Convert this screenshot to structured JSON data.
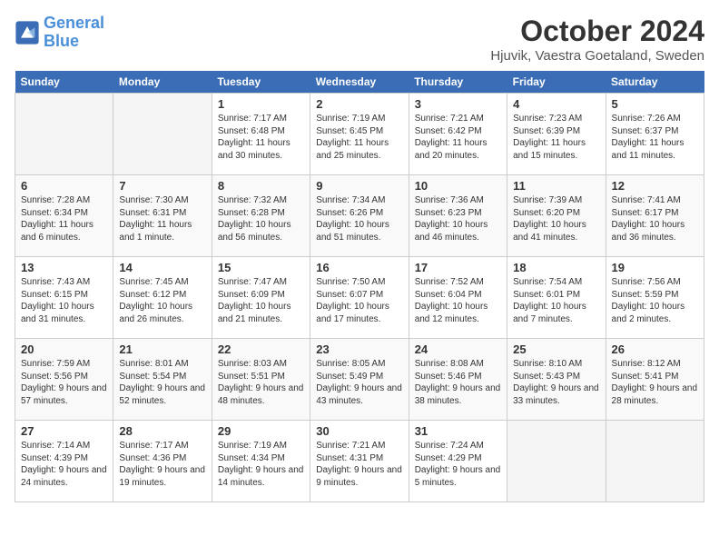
{
  "header": {
    "logo_line1": "General",
    "logo_line2": "Blue",
    "month": "October 2024",
    "location": "Hjuvik, Vaestra Goetaland, Sweden"
  },
  "weekdays": [
    "Sunday",
    "Monday",
    "Tuesday",
    "Wednesday",
    "Thursday",
    "Friday",
    "Saturday"
  ],
  "weeks": [
    [
      {
        "day": "",
        "empty": true
      },
      {
        "day": "",
        "empty": true
      },
      {
        "day": "1",
        "sunrise": "Sunrise: 7:17 AM",
        "sunset": "Sunset: 6:48 PM",
        "daylight": "Daylight: 11 hours and 30 minutes."
      },
      {
        "day": "2",
        "sunrise": "Sunrise: 7:19 AM",
        "sunset": "Sunset: 6:45 PM",
        "daylight": "Daylight: 11 hours and 25 minutes."
      },
      {
        "day": "3",
        "sunrise": "Sunrise: 7:21 AM",
        "sunset": "Sunset: 6:42 PM",
        "daylight": "Daylight: 11 hours and 20 minutes."
      },
      {
        "day": "4",
        "sunrise": "Sunrise: 7:23 AM",
        "sunset": "Sunset: 6:39 PM",
        "daylight": "Daylight: 11 hours and 15 minutes."
      },
      {
        "day": "5",
        "sunrise": "Sunrise: 7:26 AM",
        "sunset": "Sunset: 6:37 PM",
        "daylight": "Daylight: 11 hours and 11 minutes."
      }
    ],
    [
      {
        "day": "6",
        "sunrise": "Sunrise: 7:28 AM",
        "sunset": "Sunset: 6:34 PM",
        "daylight": "Daylight: 11 hours and 6 minutes."
      },
      {
        "day": "7",
        "sunrise": "Sunrise: 7:30 AM",
        "sunset": "Sunset: 6:31 PM",
        "daylight": "Daylight: 11 hours and 1 minute."
      },
      {
        "day": "8",
        "sunrise": "Sunrise: 7:32 AM",
        "sunset": "Sunset: 6:28 PM",
        "daylight": "Daylight: 10 hours and 56 minutes."
      },
      {
        "day": "9",
        "sunrise": "Sunrise: 7:34 AM",
        "sunset": "Sunset: 6:26 PM",
        "daylight": "Daylight: 10 hours and 51 minutes."
      },
      {
        "day": "10",
        "sunrise": "Sunrise: 7:36 AM",
        "sunset": "Sunset: 6:23 PM",
        "daylight": "Daylight: 10 hours and 46 minutes."
      },
      {
        "day": "11",
        "sunrise": "Sunrise: 7:39 AM",
        "sunset": "Sunset: 6:20 PM",
        "daylight": "Daylight: 10 hours and 41 minutes."
      },
      {
        "day": "12",
        "sunrise": "Sunrise: 7:41 AM",
        "sunset": "Sunset: 6:17 PM",
        "daylight": "Daylight: 10 hours and 36 minutes."
      }
    ],
    [
      {
        "day": "13",
        "sunrise": "Sunrise: 7:43 AM",
        "sunset": "Sunset: 6:15 PM",
        "daylight": "Daylight: 10 hours and 31 minutes."
      },
      {
        "day": "14",
        "sunrise": "Sunrise: 7:45 AM",
        "sunset": "Sunset: 6:12 PM",
        "daylight": "Daylight: 10 hours and 26 minutes."
      },
      {
        "day": "15",
        "sunrise": "Sunrise: 7:47 AM",
        "sunset": "Sunset: 6:09 PM",
        "daylight": "Daylight: 10 hours and 21 minutes."
      },
      {
        "day": "16",
        "sunrise": "Sunrise: 7:50 AM",
        "sunset": "Sunset: 6:07 PM",
        "daylight": "Daylight: 10 hours and 17 minutes."
      },
      {
        "day": "17",
        "sunrise": "Sunrise: 7:52 AM",
        "sunset": "Sunset: 6:04 PM",
        "daylight": "Daylight: 10 hours and 12 minutes."
      },
      {
        "day": "18",
        "sunrise": "Sunrise: 7:54 AM",
        "sunset": "Sunset: 6:01 PM",
        "daylight": "Daylight: 10 hours and 7 minutes."
      },
      {
        "day": "19",
        "sunrise": "Sunrise: 7:56 AM",
        "sunset": "Sunset: 5:59 PM",
        "daylight": "Daylight: 10 hours and 2 minutes."
      }
    ],
    [
      {
        "day": "20",
        "sunrise": "Sunrise: 7:59 AM",
        "sunset": "Sunset: 5:56 PM",
        "daylight": "Daylight: 9 hours and 57 minutes."
      },
      {
        "day": "21",
        "sunrise": "Sunrise: 8:01 AM",
        "sunset": "Sunset: 5:54 PM",
        "daylight": "Daylight: 9 hours and 52 minutes."
      },
      {
        "day": "22",
        "sunrise": "Sunrise: 8:03 AM",
        "sunset": "Sunset: 5:51 PM",
        "daylight": "Daylight: 9 hours and 48 minutes."
      },
      {
        "day": "23",
        "sunrise": "Sunrise: 8:05 AM",
        "sunset": "Sunset: 5:49 PM",
        "daylight": "Daylight: 9 hours and 43 minutes."
      },
      {
        "day": "24",
        "sunrise": "Sunrise: 8:08 AM",
        "sunset": "Sunset: 5:46 PM",
        "daylight": "Daylight: 9 hours and 38 minutes."
      },
      {
        "day": "25",
        "sunrise": "Sunrise: 8:10 AM",
        "sunset": "Sunset: 5:43 PM",
        "daylight": "Daylight: 9 hours and 33 minutes."
      },
      {
        "day": "26",
        "sunrise": "Sunrise: 8:12 AM",
        "sunset": "Sunset: 5:41 PM",
        "daylight": "Daylight: 9 hours and 28 minutes."
      }
    ],
    [
      {
        "day": "27",
        "sunrise": "Sunrise: 7:14 AM",
        "sunset": "Sunset: 4:39 PM",
        "daylight": "Daylight: 9 hours and 24 minutes."
      },
      {
        "day": "28",
        "sunrise": "Sunrise: 7:17 AM",
        "sunset": "Sunset: 4:36 PM",
        "daylight": "Daylight: 9 hours and 19 minutes."
      },
      {
        "day": "29",
        "sunrise": "Sunrise: 7:19 AM",
        "sunset": "Sunset: 4:34 PM",
        "daylight": "Daylight: 9 hours and 14 minutes."
      },
      {
        "day": "30",
        "sunrise": "Sunrise: 7:21 AM",
        "sunset": "Sunset: 4:31 PM",
        "daylight": "Daylight: 9 hours and 9 minutes."
      },
      {
        "day": "31",
        "sunrise": "Sunrise: 7:24 AM",
        "sunset": "Sunset: 4:29 PM",
        "daylight": "Daylight: 9 hours and 5 minutes."
      },
      {
        "day": "",
        "empty": true
      },
      {
        "day": "",
        "empty": true
      }
    ]
  ]
}
